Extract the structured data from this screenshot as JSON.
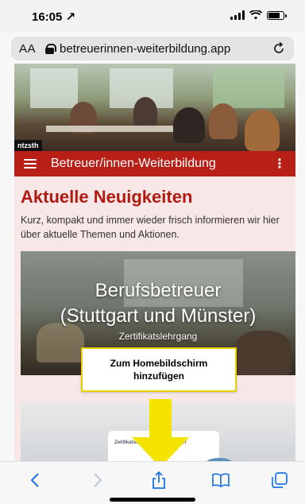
{
  "status_bar": {
    "time": "16:05 ↗"
  },
  "browser": {
    "text_size_label": "AA",
    "url": "betreuerinnen-weiterbildung.app",
    "reload_icon": "reload-icon"
  },
  "site": {
    "hero_logo": "ntzsth",
    "nav_title": "Betreuer/innen-Weiterbildung",
    "menu_icon": "hamburger-icon",
    "more_icon": "kebab-menu-icon"
  },
  "news": {
    "heading": "Aktuelle Neuigkeiten",
    "intro": "Kurz, kompakt und immer wieder frisch informieren wir hier über aktuelle Themen und Aktionen."
  },
  "course_card": {
    "title_line1": "Berufsbetreuer",
    "title_line2": "(Stuttgart und Münster)",
    "subtitle": "Zertifikatslehrgang"
  },
  "card2": {
    "label": "Zertifikatslehrgang Berufsbetreuer"
  },
  "tooltip": {
    "text_line1": "Zum Homebildschirm",
    "text_line2": "hinzufügen"
  },
  "colors": {
    "accent_red": "#b81f17",
    "highlight_yellow": "#f5e400",
    "ios_blue": "#1a73e8"
  },
  "toolbar": {
    "icons": [
      "back-icon",
      "forward-icon",
      "share-icon",
      "bookmarks-icon",
      "tabs-icon"
    ]
  }
}
